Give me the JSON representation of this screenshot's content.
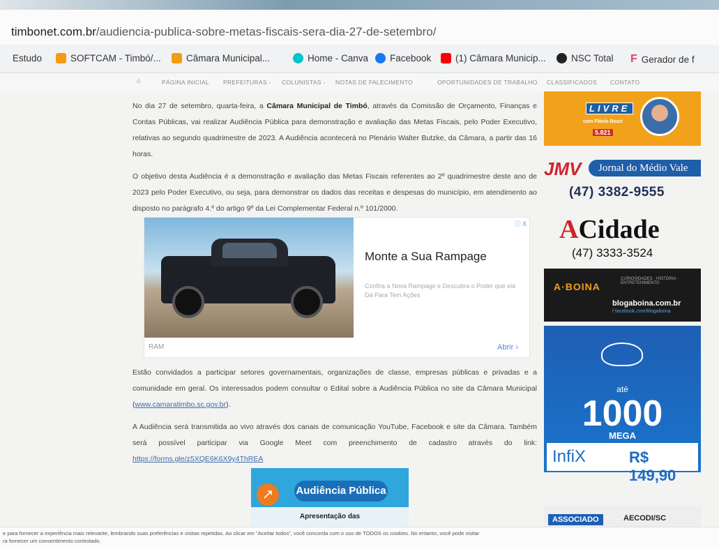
{
  "browser": {
    "url_host": "timbonet.com.br",
    "url_path": "/audiencia-publica-sobre-metas-fiscais-sera-dia-27-de-setembro/"
  },
  "bookmarks": [
    {
      "label": "Estudo",
      "color": "#f2c14e"
    },
    {
      "label": "SOFTCAM - Timbó/...",
      "color": "#f39c12"
    },
    {
      "label": "Câmara Municipal...",
      "color": "#f39c12"
    },
    {
      "label": "Home - Canva",
      "color": "#00c4cc"
    },
    {
      "label": "Facebook",
      "color": "#1877f2"
    },
    {
      "label": "(1) Câmara Municip...",
      "color": "#ff0000"
    },
    {
      "label": "NSC Total",
      "color": "#222222"
    },
    {
      "label": "Gerador de f",
      "color": "#e4405f"
    }
  ],
  "nav": {
    "home_icon": "home-icon",
    "items": [
      "PÁGINA INICIAL",
      "PREFEITURAS -",
      "COLUNISTAS -",
      "NOTAS DE FALECIMENTO",
      "OPORTUNIDADES DE TRABALHO",
      "CLASSIFICADOS",
      "CONTATO"
    ]
  },
  "article": {
    "p1_a": "No dia 27 de setembro, quarta-feira, a ",
    "p1_b": "Câmara Municipal de Timbó",
    "p1_c": ", através da Comissão de Orçamento, Finanças e Contas Públicas, vai realizar Audiência Pública para demonstração e avaliação das Metas Fiscais, pelo Poder Executivo, relativas ao segundo quadrimestre de 2023. A Audiência acontecerá no Plenário Walter Butzke, da Câmara, a partir das 16 horas.",
    "p2": "O objetivo desta Audiência é a demonstração e avaliação das Metas Fiscais referentes ao 2º quadrimestre deste ano de 2023 pelo Poder Executivo, ou seja, para demonstrar os dados das receitas e despesas do município, em atendimento ao disposto no parágrafo 4.º do artigo 9º da Lei Complementar Federal n.º 101/2000.",
    "p3_a": "Estão convidados a participar setores governamentais, organizações de classe, empresas públicas e privadas e a comunidade em geral. Os interessados podem consultar o Edital sobre a Audiência Pública no site da Câmara Municipal (",
    "p3_link": "www.camaratimbo.sc.gov.br",
    "p3_b": ").",
    "p4_a": "A Audiência será transmitida ao vivo através dos canais de comunicação YouTube, Facebook e site da Câmara. Também será possível participar via Google Meet com preenchimento de cadastro através do link: ",
    "p4_link": "https://forms.gle/z5XQE6K6X9y4ThREA"
  },
  "ad": {
    "headline": "Monte a Sua Rampage",
    "desc": "Confira a Nova Rampage e Descubra o Poder que ela Dá Para Tem Ações",
    "brand": "RAM",
    "open": "Abrir ›",
    "adchoice": "ⓘ X"
  },
  "audiencia_banner": {
    "title": "Audiência Pública",
    "sub": "Apresentação das"
  },
  "sidebar": {
    "livre": "LIVRE",
    "livre_host": "com Flávio Bozzi",
    "livre_num": "5.821",
    "jmv_logo": "JMV",
    "jmv_name": "Jornal do Médio Vale",
    "jmv_phone": "(47) 3382-9555",
    "acidade_a": "A",
    "acidade_rest": "Cidade",
    "acidade_phone": "(47) 3333-3524",
    "boina_name": "A·BOINA",
    "boina_tag": "CURIOSIDADES · HISTÓRIA · ENTRETENIMENTO",
    "boina_site": "blogaboina.com.br",
    "boina_fb": "f facebook.com/blogaboina",
    "infix_ate": "até",
    "infix_num": "1000",
    "infix_mega": "MEGA",
    "infix_brand": "InfiX",
    "infix_price": "R$ 149,90",
    "assoc_a": "ASSOCIADO",
    "assoc_b": "AECODI/SC"
  },
  "cookie": {
    "line1": "e para fornecer a experiência mais relevante, lembrando suas preferências e visitas repetidas. Ao clicar em \"Aceitar todos\", você concorda com o uso de TODOS os cookies. No entanto, você pode visitar",
    "line2": "ra fornecer um consentimento controlado."
  }
}
